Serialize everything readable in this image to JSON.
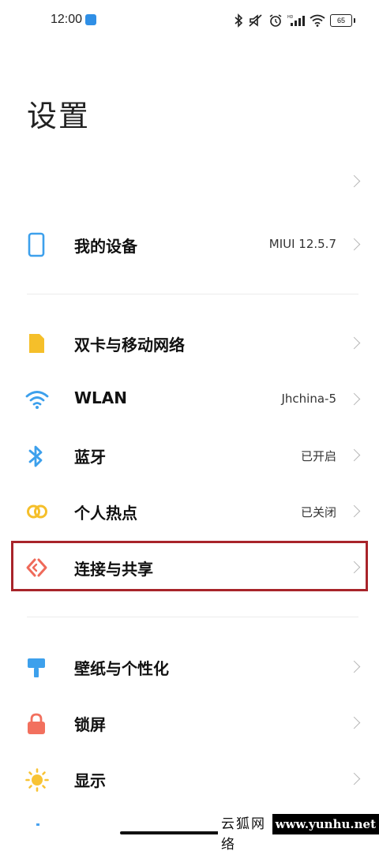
{
  "status_bar": {
    "time": "12:00",
    "battery": "65"
  },
  "page": {
    "title": "设置"
  },
  "rows": {
    "my_device": {
      "label": "我的设备",
      "value": "MIUI 12.5.7",
      "icon": "phone-icon"
    },
    "sim": {
      "label": "双卡与移动网络",
      "icon": "sim-card-icon"
    },
    "wlan": {
      "label": "WLAN",
      "value": "Jhchina-5",
      "icon": "wifi-icon"
    },
    "bluetooth": {
      "label": "蓝牙",
      "value": "已开启",
      "icon": "bluetooth-icon"
    },
    "hotspot": {
      "label": "个人热点",
      "value": "已关闭",
      "icon": "hotspot-icon"
    },
    "connection": {
      "label": "连接与共享",
      "icon": "connection-share-icon"
    },
    "wallpaper": {
      "label": "壁纸与个性化",
      "icon": "brush-icon"
    },
    "lockscreen": {
      "label": "锁屏",
      "icon": "lock-icon"
    },
    "display": {
      "label": "显示",
      "icon": "sun-icon"
    }
  },
  "watermark": {
    "text": "云狐网络",
    "url": "www.yunhu.net"
  },
  "colors": {
    "highlight": "#a8242a",
    "accent_blue": "#3da0ec",
    "sim_yellow": "#f5bf2a",
    "connection_red": "#ef6a5a",
    "lock_red": "#f2705e",
    "sun_yellow": "#f8c334"
  }
}
